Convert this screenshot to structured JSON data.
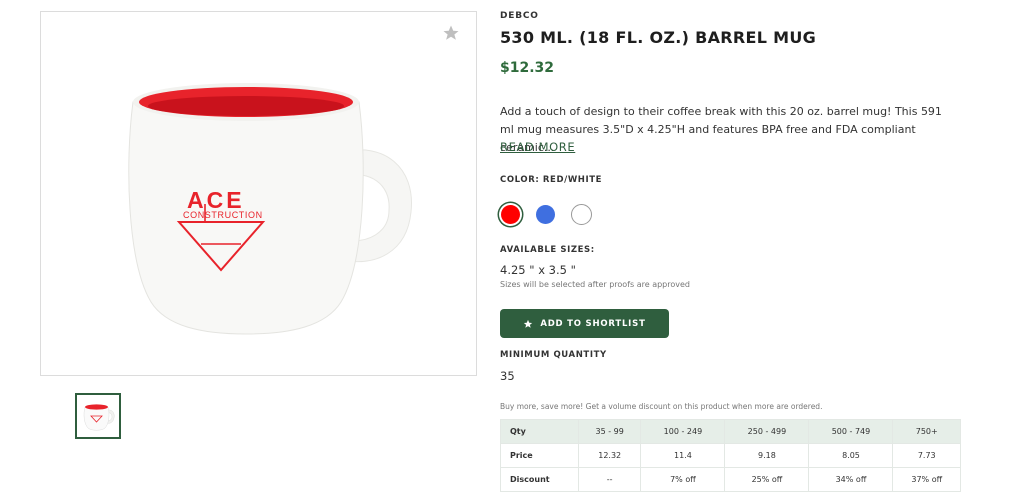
{
  "product": {
    "brand": "DEBCO",
    "title": "530 ML. (18 FL. OZ.) BARREL MUG",
    "price": "$12.32",
    "description": "Add a touch of design to their coffee break with this 20 oz. barrel mug! This 591 ml mug measures 3.5\"D x 4.25\"H and features BPA free and FDA compliant ceramic...",
    "read_more": "READ MORE",
    "image_text": {
      "logo_top": "ACE",
      "logo_sub": "CONSTRUCTION"
    }
  },
  "color": {
    "label": "COLOR: RED/WHITE",
    "swatches": [
      {
        "name": "red",
        "hex": "#ff0000",
        "selected": true
      },
      {
        "name": "blue",
        "hex": "#3f6fe0",
        "selected": false
      },
      {
        "name": "white",
        "hex": "#ffffff",
        "selected": false
      }
    ]
  },
  "sizes": {
    "label": "AVAILABLE SIZES:",
    "value": "4.25 \" x 3.5 \"",
    "note": "Sizes will be selected after proofs are approved"
  },
  "actions": {
    "shortlist_label": "ADD TO SHORTLIST"
  },
  "minimum_quantity": {
    "label": "MINIMUM QUANTITY",
    "value": "35"
  },
  "volume": {
    "note": "Buy more, save more! Get a volume discount on this product when more are ordered.",
    "headers": [
      "Qty",
      "35 - 99",
      "100 - 249",
      "250 - 499",
      "500 - 749",
      "750+"
    ],
    "rows": [
      [
        "Price",
        "12.32",
        "11.4",
        "9.18",
        "8.05",
        "7.73"
      ],
      [
        "Discount",
        "--",
        "7% off",
        "25% off",
        "34% off",
        "37% off"
      ]
    ]
  },
  "colors": {
    "accent": "#2f5e3e",
    "price": "#2f6b3c",
    "mug_red": "#e8232b"
  }
}
